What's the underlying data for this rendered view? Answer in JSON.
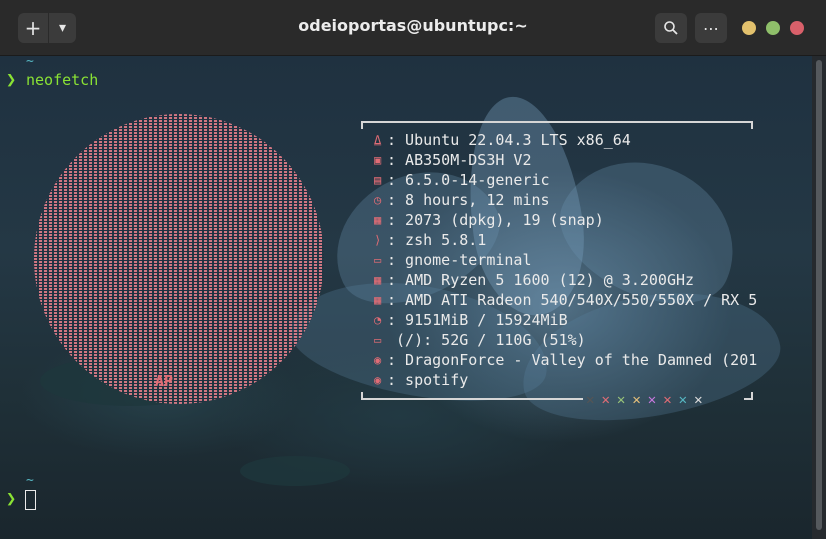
{
  "titlebar": {
    "title": "odeioportas@ubuntupc:~",
    "new_tab_icon": "+",
    "dropdown_icon": "▾",
    "search_icon": "⌕",
    "menu_icon": "⋯",
    "colors": {
      "minimize": "#e2c16d",
      "maximize": "#8fbf6a",
      "close": "#d9606a"
    }
  },
  "prompt1": {
    "dir": "~",
    "arrow": "❯",
    "command": "neofetch"
  },
  "logo": {
    "label": "AP"
  },
  "info": [
    {
      "icon": "⍙",
      "text": ": Ubuntu 22.04.3 LTS x86_64"
    },
    {
      "icon": "▣",
      "text": ": AB350M-DS3H V2"
    },
    {
      "icon": "▤",
      "text": ": 6.5.0-14-generic"
    },
    {
      "icon": "◷",
      "text": ": 8 hours, 12 mins"
    },
    {
      "icon": "▦",
      "text": ": 2073 (dpkg), 19 (snap)"
    },
    {
      "icon": "⟩",
      "text": ": zsh 5.8.1"
    },
    {
      "icon": "▭",
      "text": ": gnome-terminal"
    },
    {
      "icon": "▦",
      "text": ": AMD Ryzen 5 1600 (12) @ 3.200GHz"
    },
    {
      "icon": "▦",
      "text": ": AMD ATI Radeon 540/540X/550/550X / RX 5"
    },
    {
      "icon": "◔",
      "text": ": 9151MiB / 15924MiB"
    },
    {
      "icon": "▭",
      "text": " (/): 52G / 110G (51%)"
    },
    {
      "icon": "◉",
      "text": ": DragonForce - Valley of the Damned (201"
    },
    {
      "icon": "◉",
      "text": ": spotify"
    }
  ],
  "palette": [
    "#555555",
    "#e06c75",
    "#98c379",
    "#e5c07b",
    "#c678dd",
    "#e06c75",
    "#56b6c2",
    "#dcdcdc"
  ],
  "palette_glyph": "✕",
  "prompt2": {
    "dir": "~",
    "arrow": "❯"
  }
}
